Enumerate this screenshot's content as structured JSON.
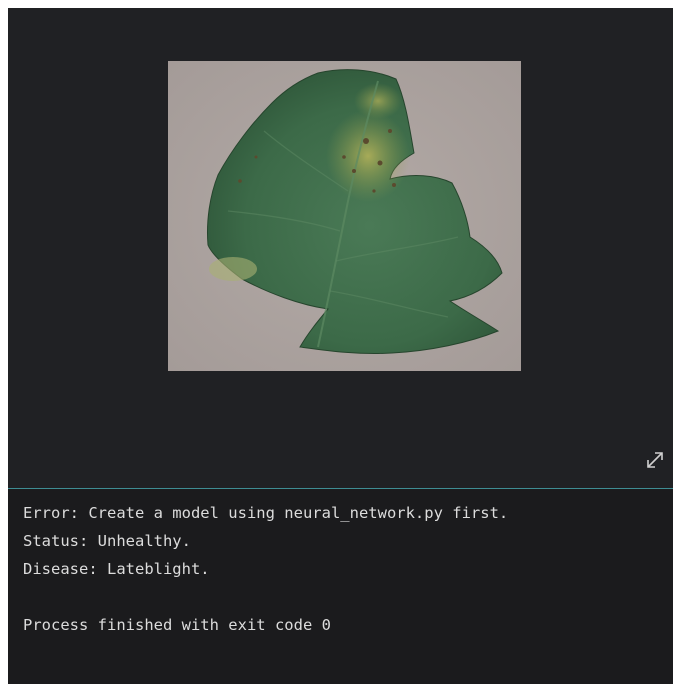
{
  "viewer": {
    "image_subject": "leaf-image",
    "expand_icon": "expand-diagonal-arrows-icon"
  },
  "console": {
    "lines": [
      "Error: Create a model using neural_network.py first.",
      "Status: Unhealthy.",
      "Disease: Lateblight.",
      "",
      "Process finished with exit code 0"
    ]
  },
  "colors": {
    "background": "#1e1f22",
    "divider": "#3e8d93",
    "text": "#dcdcdc"
  }
}
